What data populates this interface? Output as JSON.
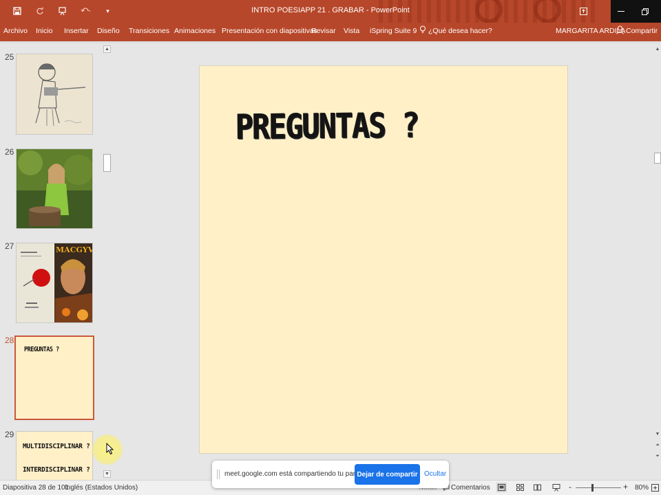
{
  "window": {
    "title": "INTRO POESIAPP 21 . GRABAR - PowerPoint",
    "accent": "#b7472a"
  },
  "qat": {
    "icons": [
      "save-icon",
      "undo-icon",
      "present-icon",
      "redo-icon",
      "more-icon"
    ]
  },
  "ribbon": {
    "tabs": [
      "Archivo",
      "Inicio",
      "Insertar",
      "Diseño",
      "Transiciones",
      "Animaciones",
      "Presentación con diapositivas",
      "Revisar",
      "Vista",
      "iSpring Suite 9"
    ],
    "search_placeholder": "¿Qué desea hacer?",
    "user_name": "MARGARITA ARDILA",
    "share_label": "Compartir"
  },
  "thumbnails": {
    "items": [
      {
        "number": "25",
        "kind": "drawing"
      },
      {
        "number": "26",
        "kind": "photo"
      },
      {
        "number": "27",
        "kind": "book-and-poster",
        "poster_title": "MACGYVER"
      },
      {
        "number": "28",
        "kind": "text",
        "text": "PREGUNTAS ?",
        "active": true
      },
      {
        "number": "29",
        "kind": "text",
        "lines": [
          "MULTIDISCIPLINAR ?",
          "INTERDISCIPLINAR ?"
        ]
      }
    ]
  },
  "slide": {
    "title": "PREGUNTAS ?",
    "background": "#fff0c8"
  },
  "status": {
    "slide_info": "Diapositiva 28 de 101",
    "language": "Inglés (Estados Unidos)",
    "notes_label": "Notas",
    "comments_label": "Comentarios",
    "zoom": "80%"
  },
  "share_banner": {
    "message": "meet.google.com está compartiendo tu pantalla.",
    "stop_label": "Dejar de compartir",
    "hide_label": "Ocultar",
    "button_color": "#1a73e8"
  }
}
